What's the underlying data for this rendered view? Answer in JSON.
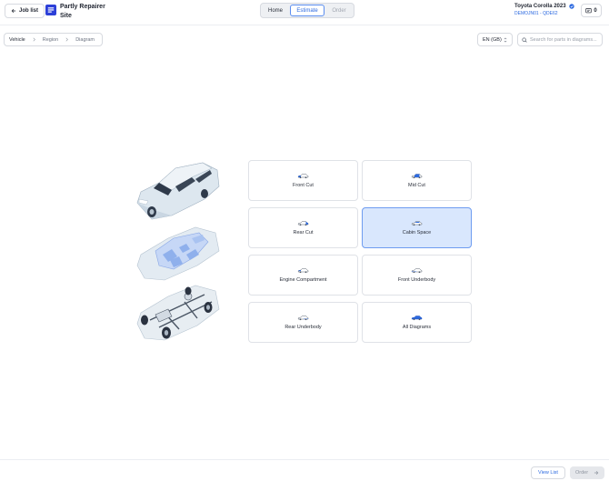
{
  "header": {
    "job_list_label": "Job list",
    "site_name": "Partly Repairer Site",
    "tabs": {
      "home": "Home",
      "estimate": "Estimate",
      "order": "Order"
    },
    "active_tab": "Estimate",
    "vehicle": {
      "name": "Toyota Corolla 2023",
      "code": "DEMOJN01 - QDE62"
    },
    "cart_count": "0"
  },
  "toolbar": {
    "breadcrumb": [
      "Vehicle",
      "Region",
      "Diagram"
    ],
    "language": "EN (GB)",
    "search_placeholder": "Search for parts in diagrams..."
  },
  "regions": [
    {
      "label": "Front Cut",
      "selected": false
    },
    {
      "label": "Mid Cut",
      "selected": false
    },
    {
      "label": "Rear Cut",
      "selected": false
    },
    {
      "label": "Cabin Space",
      "selected": true
    },
    {
      "label": "Engine Compartment",
      "selected": false
    },
    {
      "label": "Front Underbody",
      "selected": false
    },
    {
      "label": "Rear Underbody",
      "selected": false
    },
    {
      "label": "All Diagrams",
      "selected": false
    }
  ],
  "footer": {
    "view_list_label": "View List",
    "order_label": "Order"
  },
  "colors": {
    "accent": "#2d6ae0",
    "selected_bg": "#d9e7fd",
    "logo": "#2c3fd8"
  }
}
